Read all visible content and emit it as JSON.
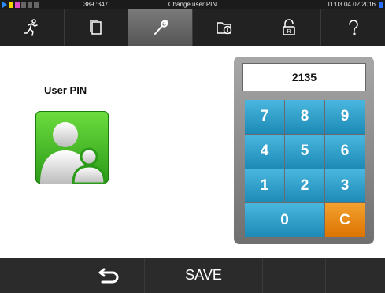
{
  "statusbar": {
    "counter": "389 :347",
    "title": "Change user PIN",
    "time": "11:03  04.02.2016",
    "icons": [
      "play-icon",
      "battery-level-icon",
      "signal-icon",
      "network-icon",
      "user-icon",
      "lock-icon"
    ]
  },
  "topmenu": {
    "tabs": [
      {
        "icon": "running-man-icon"
      },
      {
        "icon": "documents-icon"
      },
      {
        "icon": "wrench-icon",
        "active": true
      },
      {
        "icon": "info-folder-icon"
      },
      {
        "icon": "lock-icon"
      },
      {
        "icon": "question-icon"
      }
    ]
  },
  "user": {
    "title": "User PIN",
    "icon": "user-group-icon"
  },
  "keypad": {
    "display_value": "2135",
    "keys": [
      "7",
      "8",
      "9",
      "4",
      "5",
      "6",
      "1",
      "2",
      "3",
      "0",
      "C"
    ],
    "colors": {
      "key": "#2ea2cf",
      "clear": "#ec8a12"
    }
  },
  "bottom": {
    "back_icon": "back-arrow-icon",
    "save_label": "SAVE"
  }
}
